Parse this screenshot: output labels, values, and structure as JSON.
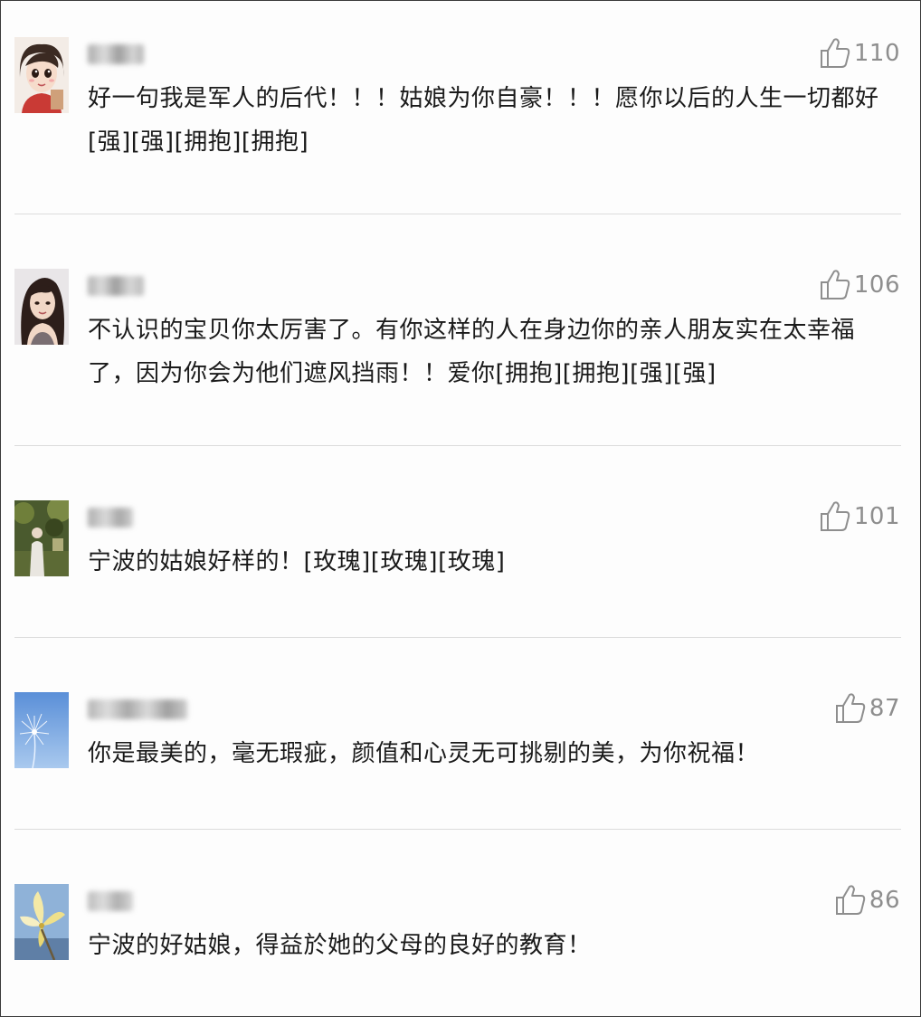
{
  "comments": [
    {
      "likes": "110",
      "text": "好一句我是军人的后代！！！姑娘为你自豪！！！愿你以后的人生一切都好[强][强][拥抱][拥抱]"
    },
    {
      "likes": "106",
      "text": "不认识的宝贝你太厉害了。有你这样的人在身边你的亲人朋友实在太幸福了，因为你会为他们遮风挡雨！！爱你[拥抱][拥抱][强][强]"
    },
    {
      "likes": "101",
      "text": "宁波的姑娘好样的！[玫瑰][玫瑰][玫瑰]"
    },
    {
      "likes": "87",
      "text": "你是最美的，毫无瑕疵，颜值和心灵无可挑剔的美，为你祝福！"
    },
    {
      "likes": "86",
      "text": "宁波的好姑娘，得益於她的父母的良好的教育！"
    }
  ],
  "icons": {
    "like": "thumbs-up-icon",
    "avatar": "user-avatar"
  },
  "colors": {
    "text": "#1a1a1a",
    "meta": "#8e8e8e",
    "divider": "#dcdcdc"
  }
}
